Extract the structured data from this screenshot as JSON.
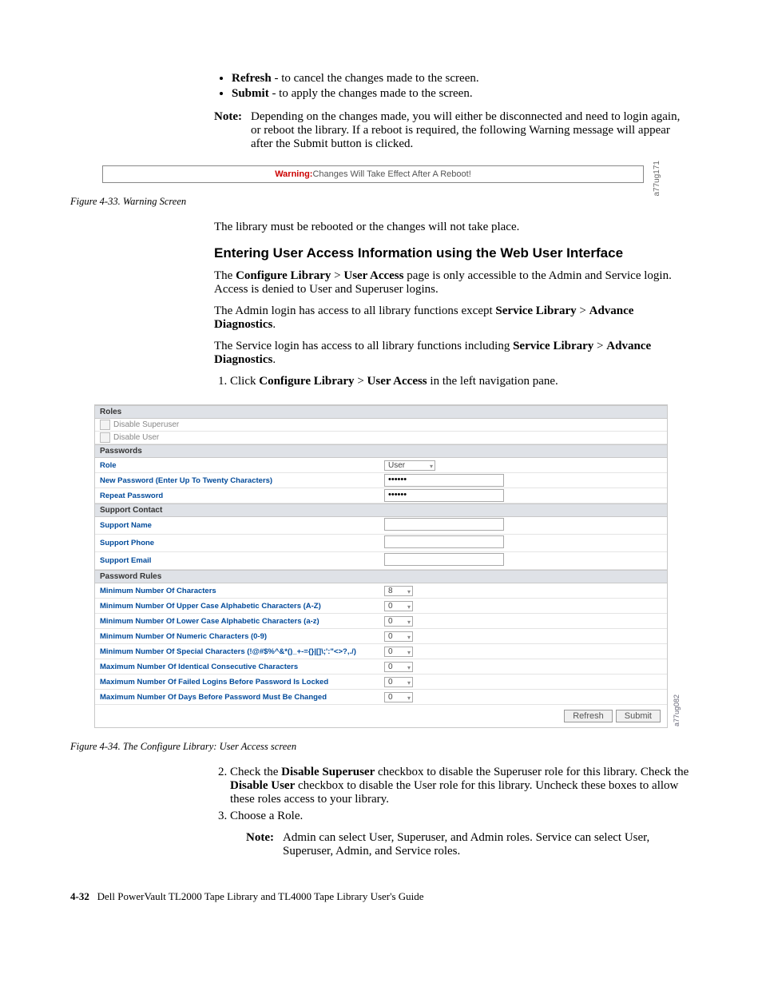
{
  "bullets": [
    {
      "term": "Refresh",
      "rest": " - to cancel the changes made to the screen."
    },
    {
      "term": "Submit",
      "rest": " - to apply the changes made to the screen."
    }
  ],
  "note1_label": "Note:",
  "note1_body": " Depending on the changes made, you will either be disconnected and need to login again, or reboot the library. If a reboot is required, the following Warning message will appear after the Submit button is clicked.",
  "warning_prefix": "Warning:",
  "warning_text": " Changes Will Take Effect After A Reboot!",
  "sidecode1": "a77ug171",
  "fig33": "Figure 4-33. Warning Screen",
  "reboot_p": "The library must be rebooted or the changes will not take place.",
  "section_h": "Entering User Access Information using the Web User Interface",
  "p_intro_1a": "The ",
  "p_intro_1b": "Configure Library",
  "p_intro_1c": " > ",
  "p_intro_1d": "User Access",
  "p_intro_1e": " page is only accessible to the Admin and Service login. Access is denied to User and Superuser logins.",
  "p_admin_1": "The Admin login has access to all library functions except ",
  "p_admin_2": "Service Library",
  "p_admin_3": " > ",
  "p_admin_4": "Advance Diagnostics",
  "p_admin_5": ".",
  "p_service_1": "The Service login has access to all library functions including ",
  "p_service_2": "Service Library",
  "p_service_3": " > ",
  "p_service_4": "Advance Diagnostics",
  "p_service_5": ".",
  "step1_a": "Click ",
  "step1_b": "Configure Library",
  "step1_c": " > ",
  "step1_d": "User Access",
  "step1_e": " in the left navigation pane.",
  "ui": {
    "hdr_roles": "Roles",
    "chk_superuser": "Disable Superuser",
    "chk_user": "Disable User",
    "hdr_passwords": "Passwords",
    "lbl_role": "Role",
    "val_role": "User",
    "lbl_newpw": "New Password (Enter Up To Twenty Characters)",
    "lbl_reppw": "Repeat Password",
    "pw_dots": "••••••",
    "hdr_support": "Support Contact",
    "lbl_sname": "Support Name",
    "lbl_sphone": "Support Phone",
    "lbl_semail": "Support Email",
    "hdr_rules": "Password Rules",
    "rules": [
      {
        "label": "Minimum Number Of Characters",
        "val": "8"
      },
      {
        "label": "Minimum Number Of Upper Case Alphabetic Characters (A-Z)",
        "val": "0"
      },
      {
        "label": "Minimum Number Of Lower Case Alphabetic Characters (a-z)",
        "val": "0"
      },
      {
        "label": "Minimum Number Of Numeric Characters (0-9)",
        "val": "0"
      },
      {
        "label": "Minimum Number Of Special Characters (!@#$%^&*()_+-={}|[]\\;':\"<>?,./)",
        "val": "0"
      },
      {
        "label": "Maximum Number Of Identical Consecutive Characters",
        "val": "0"
      },
      {
        "label": "Maximum Number Of Failed Logins Before Password Is Locked",
        "val": "0"
      },
      {
        "label": "Maximum Number Of Days Before Password Must Be Changed",
        "val": "0"
      }
    ],
    "btn_refresh": "Refresh",
    "btn_submit": "Submit"
  },
  "sidecode2": "a77ug082",
  "fig34": "Figure 4-34. The Configure Library: User Access screen",
  "step2_a": "Check the ",
  "step2_b": "Disable Superuser",
  "step2_c": " checkbox to disable the Superuser role for this library. Check the ",
  "step2_d": "Disable User",
  "step2_e": " checkbox to disable the User role for this library. Uncheck these boxes to allow these roles access to your library.",
  "step3": "Choose a Role.",
  "note2_label": "Note:",
  "note2_body": " Admin can select User, Superuser, and Admin roles. Service can select User, Superuser, Admin, and Service roles.",
  "footer_pg": "4-32",
  "footer_title": "Dell PowerVault TL2000 Tape Library and TL4000 Tape Library User's Guide"
}
